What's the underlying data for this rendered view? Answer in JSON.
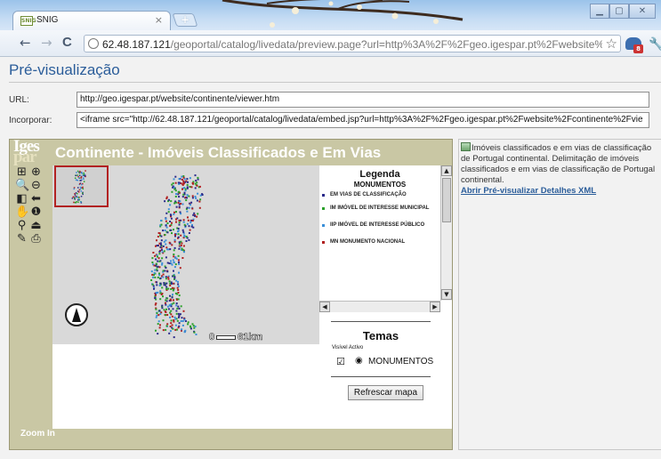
{
  "browser": {
    "tab_title": "SNIG",
    "tab_close": "×",
    "new_tab": "+",
    "favicon_text": "SNIG",
    "window_buttons": [
      "▁",
      "▢",
      "✕"
    ],
    "nav": {
      "back": "←",
      "forward": "→",
      "reload": "C"
    },
    "address_host": "62.48.187.121",
    "address_rest": "/geoportal/catalog/livedata/preview.page?url=http%3A%2F%2Fgeo.igespar.pt%2Fwebsite%2Fco",
    "star": "☆",
    "extension_badge": "8",
    "wrench": "🔧"
  },
  "page": {
    "title": "Pré-visualização",
    "url_label": "URL:",
    "url_value": "http://geo.igespar.pt/website/continente/viewer.htm",
    "embed_label": "Incorporar:",
    "embed_value": "<iframe src=\"http://62.48.187.121/geoportal/catalog/livedata/embed.jsp?url=http%3A%2F%2Fgeo.igespar.pt%2Fwebsite%2Fcontinente%2Fvie"
  },
  "viewer": {
    "logo_line1": "Iges",
    "logo_line2": "par",
    "map_title": "Continente - Imóveis Classificados e Em Vias",
    "tools": [
      {
        "name": "zoom-extent-icon",
        "glyph": "⊞"
      },
      {
        "name": "zoom-box-icon",
        "glyph": "⊕"
      },
      {
        "name": "zoom-in-icon",
        "glyph": "🔍"
      },
      {
        "name": "zoom-out-icon",
        "glyph": "⊖"
      },
      {
        "name": "zoom-previous-icon",
        "glyph": "◧"
      },
      {
        "name": "back-arrow-icon",
        "glyph": "⬅"
      },
      {
        "name": "pan-hand-icon",
        "glyph": "✋"
      },
      {
        "name": "info-icon",
        "glyph": "❶"
      },
      {
        "name": "find-binoculars-icon",
        "glyph": "⚲"
      },
      {
        "name": "measure-icon",
        "glyph": "⏏"
      },
      {
        "name": "eraser-icon",
        "glyph": "✎"
      },
      {
        "name": "print-icon",
        "glyph": "⎙"
      }
    ],
    "scale_left": "0",
    "scale_right": "61km",
    "zoom_status": "Zoom In",
    "legend": {
      "title": "Legenda",
      "subtitle": "MONUMENTOS",
      "items": [
        {
          "label": "EM VIAS DE CLASSIFICAÇÃO",
          "color": "#2a2a8a"
        },
        {
          "label": "IM IMÓVEL DE INTERESSE MUNICIPAL",
          "color": "#2aa02a"
        },
        {
          "label": "IIP IMÓVEL DE INTERESSE PÚBLICO",
          "color": "#3a8fd8"
        },
        {
          "label": "MN MONUMENTO NACIONAL",
          "color": "#b01e1e"
        }
      ]
    },
    "temas": {
      "title": "Temas",
      "col_visible": "Visível",
      "col_active": "Activo",
      "checkbox": "☑",
      "radio": "◉",
      "layer": "MONUMENTOS",
      "refresh": "Refrescar mapa"
    }
  },
  "info": {
    "description": "Imóveis classificados e em vias de classificação de Portugal continental. Delimitação de imóveis classificados e em vias de classificação de Portugal continental.",
    "link_open": "Abrir",
    "link_preview": "Pré-visualizar",
    "link_details": "Detalhes",
    "link_xml": "XML"
  }
}
